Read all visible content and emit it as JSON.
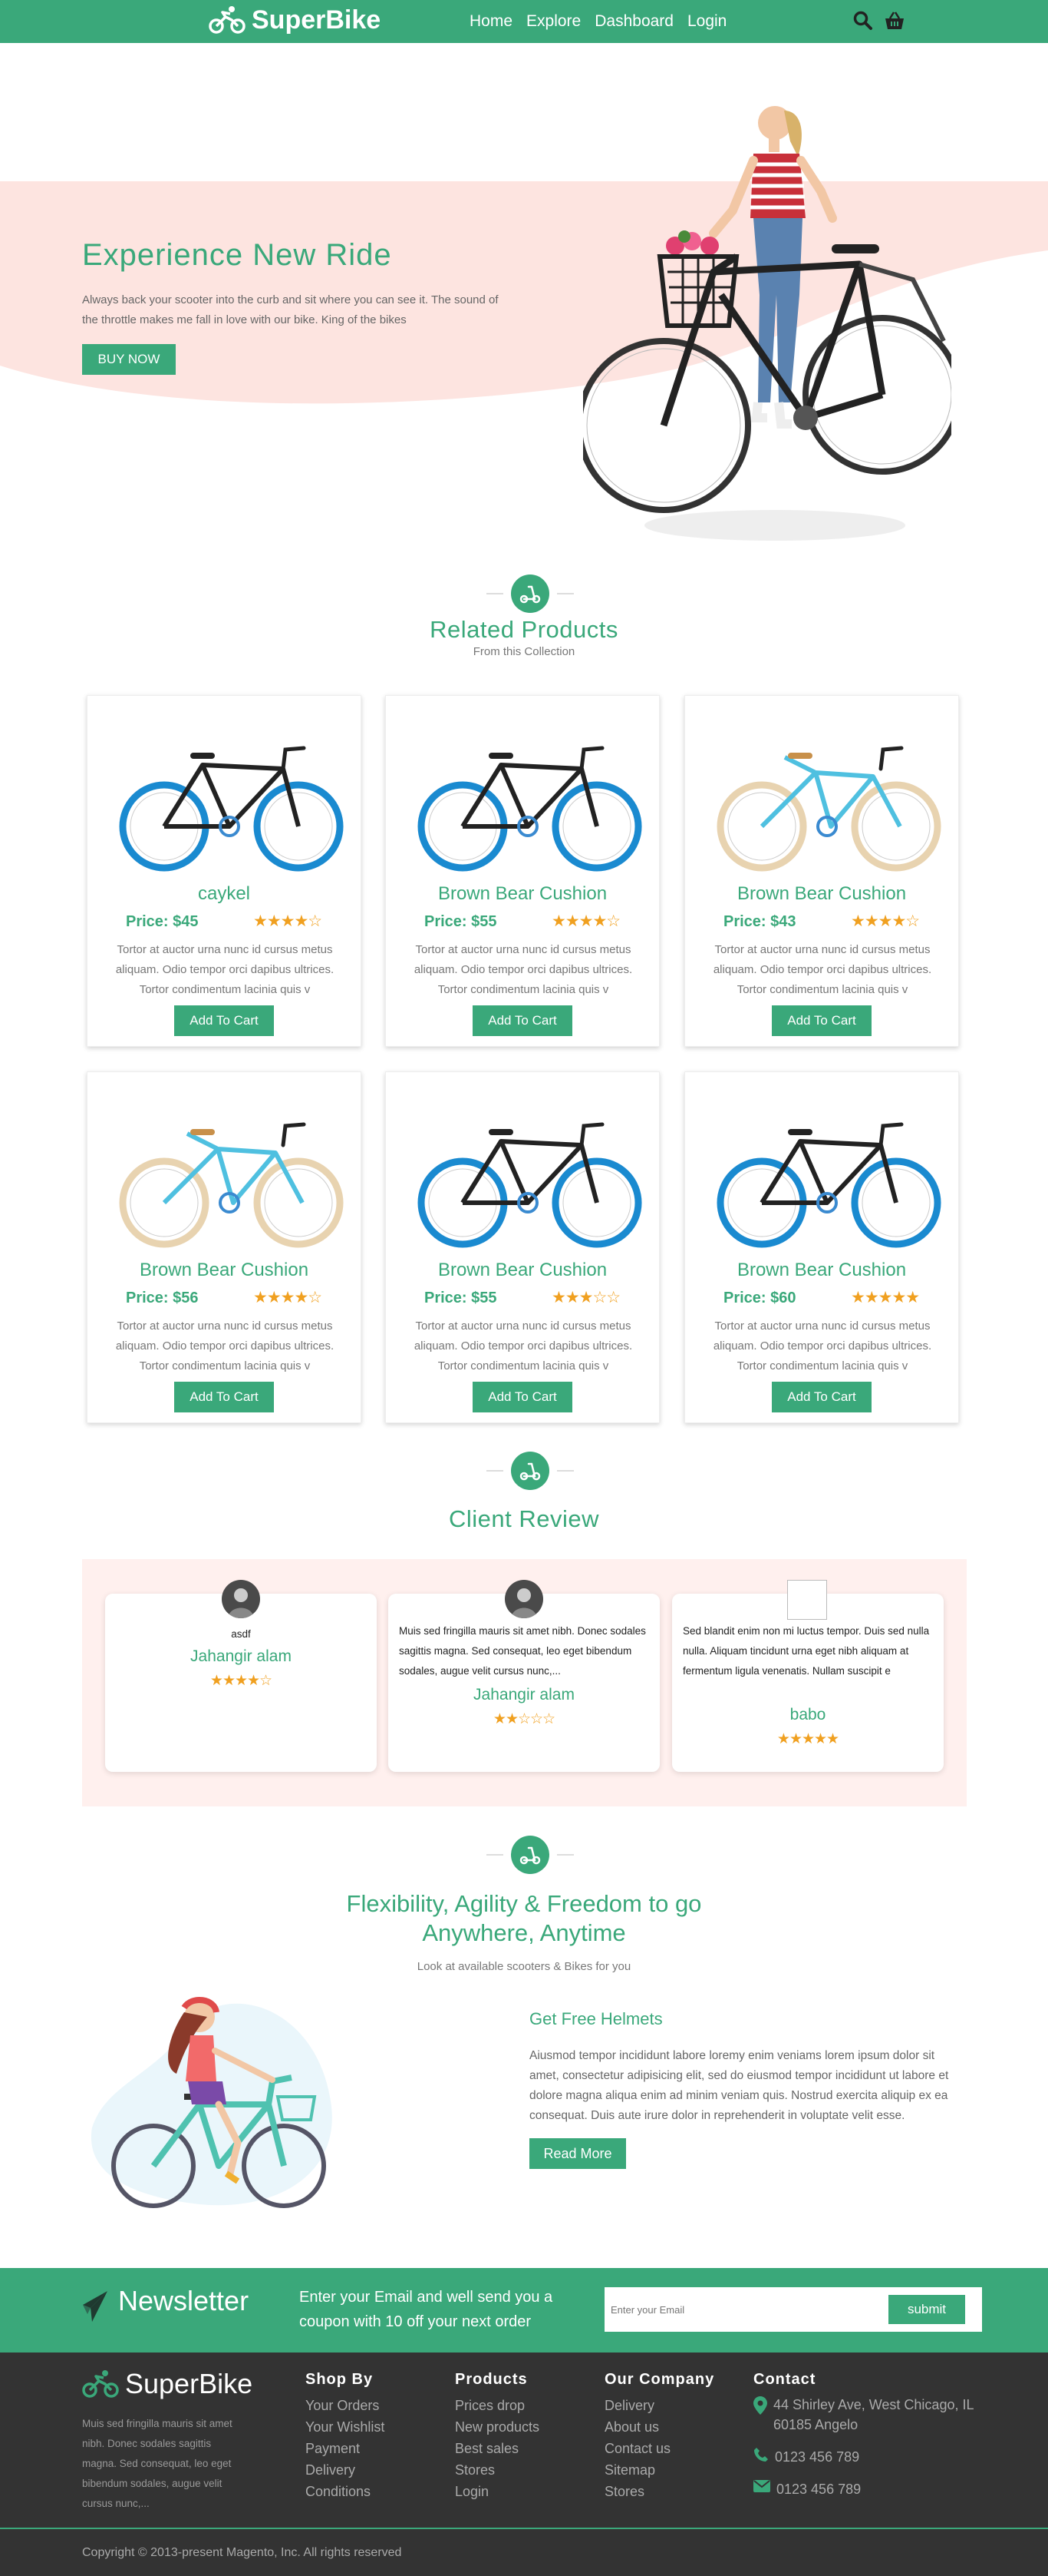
{
  "nav": {
    "brand": "SuperBike",
    "links": [
      "Home",
      "Explore",
      "Dashboard",
      "Login"
    ]
  },
  "hero": {
    "title": "Experience New Ride",
    "text": "Always back your scooter into the curb and sit where you can see it. The sound of the throttle makes me fall in love with our bike. King of the bikes",
    "button": "BUY NOW"
  },
  "related": {
    "title": "Related Products",
    "subtitle": "From this Collection",
    "products": [
      {
        "name": "caykel",
        "price": "Price: $45",
        "stars": "★★★★☆",
        "rating": 4,
        "desc": "Tortor at auctor urna nunc id cursus metus aliquam. Odio tempor orci dapibus ultrices. Tortor condimentum lacinia quis v",
        "button": "Add To Cart",
        "style": "black-blue"
      },
      {
        "name": "Brown Bear Cushion",
        "price": "Price: $55",
        "stars": "★★★★☆",
        "rating": 4,
        "desc": "Tortor at auctor urna nunc id cursus metus aliquam. Odio tempor orci dapibus ultrices. Tortor condimentum lacinia quis v",
        "button": "Add To Cart",
        "style": "black-blue"
      },
      {
        "name": "Brown Bear Cushion",
        "price": "Price: $43",
        "stars": "★★★★☆",
        "rating": 4,
        "desc": "Tortor at auctor urna nunc id cursus metus aliquam. Odio tempor orci dapibus ultrices. Tortor condimentum lacinia quis v",
        "button": "Add To Cart",
        "style": "cyan-cream"
      },
      {
        "name": "Brown Bear Cushion",
        "price": "Price: $56",
        "stars": "★★★★☆",
        "rating": 4,
        "desc": "Tortor at auctor urna nunc id cursus metus aliquam. Odio tempor orci dapibus ultrices. Tortor condimentum lacinia quis v",
        "button": "Add To Cart",
        "style": "cyan-cream"
      },
      {
        "name": "Brown Bear Cushion",
        "price": "Price: $55",
        "stars": "★★★☆☆",
        "rating": 3,
        "desc": "Tortor at auctor urna nunc id cursus metus aliquam. Odio tempor orci dapibus ultrices. Tortor condimentum lacinia quis v",
        "button": "Add To Cart",
        "style": "black-blue"
      },
      {
        "name": "Brown Bear Cushion",
        "price": "Price: $60",
        "stars": "★★★★★",
        "rating": 5,
        "desc": "Tortor at auctor urna nunc id cursus metus aliquam. Odio tempor orci dapibus ultrices. Tortor condimentum lacinia quis v",
        "button": "Add To Cart",
        "style": "black-blue"
      }
    ]
  },
  "reviews": {
    "title": "Client Review",
    "items": [
      {
        "text": "asdf",
        "name": "Jahangir alam",
        "stars": "★★★★☆",
        "rating": 4
      },
      {
        "text": "Muis sed fringilla mauris sit amet nibh. Donec sodales sagittis magna. Sed consequat, leo eget bibendum sodales, augue velit cursus nunc,...",
        "name": "Jahangir alam",
        "stars": "★★☆☆☆",
        "rating": 2
      },
      {
        "text": "Sed blandit enim non mi luctus tempor. Duis sed nulla nulla. Aliquam tincidunt urna eget nibh aliquam at fermentum ligula venenatis. Nullam suscipit e",
        "name": "babo",
        "stars": "★★★★★",
        "rating": 5
      }
    ]
  },
  "feature": {
    "title_line1": "Flexibility, Agility & Freedom to go",
    "title_line2": "Anywhere, Anytime",
    "subtitle": "Look at available scooters & Bikes for you",
    "heading": "Get Free Helmets",
    "text": "Aiusmod tempor incididunt labore loremy enim veniams lorem ipsum dolor sit amet, consectetur adipisicing elit, sed do eiusmod tempor incididunt ut labore et dolore magna aliqua enim ad minim veniam quis. Nostrud exercita aliquip ex ea consequat. Duis aute irure dolor in reprehenderit in voluptate velit esse.",
    "button": "Read More"
  },
  "newsletter": {
    "title": "Newsletter",
    "text": "Enter your Email and well send you a coupon with 10 off your next order",
    "placeholder": "Enter your Email",
    "button": "submit"
  },
  "footer": {
    "brand": "SuperBike",
    "about": "Muis sed fringilla mauris sit amet nibh. Donec sodales sagittis magna. Sed consequat, leo eget bibendum sodales, augue velit cursus nunc,...",
    "shop": {
      "title": "Shop By",
      "links": [
        "Your Orders",
        "Your Wishlist",
        "Payment",
        "Delivery",
        "Conditions"
      ]
    },
    "products": {
      "title": "Products",
      "links": [
        "Prices drop",
        "New products",
        "Best sales",
        "Stores",
        "Login"
      ]
    },
    "company": {
      "title": "Our Company",
      "links": [
        "Delivery",
        "About us",
        "Contact us",
        "Sitemap",
        "Stores"
      ]
    },
    "contact": {
      "title": "Contact",
      "address": "44 Shirley Ave, West Chicago, IL 60185 Angelo",
      "phone": "0123 456 789",
      "mail": "0123 456 789"
    },
    "copyright": "Copyright © 2013-present Magento, Inc. All rights reserved"
  },
  "colors": {
    "accent": "#3aa87a",
    "hero_bg": "#fde4e0",
    "star": "#f0a020",
    "footer_bg": "#333333"
  }
}
